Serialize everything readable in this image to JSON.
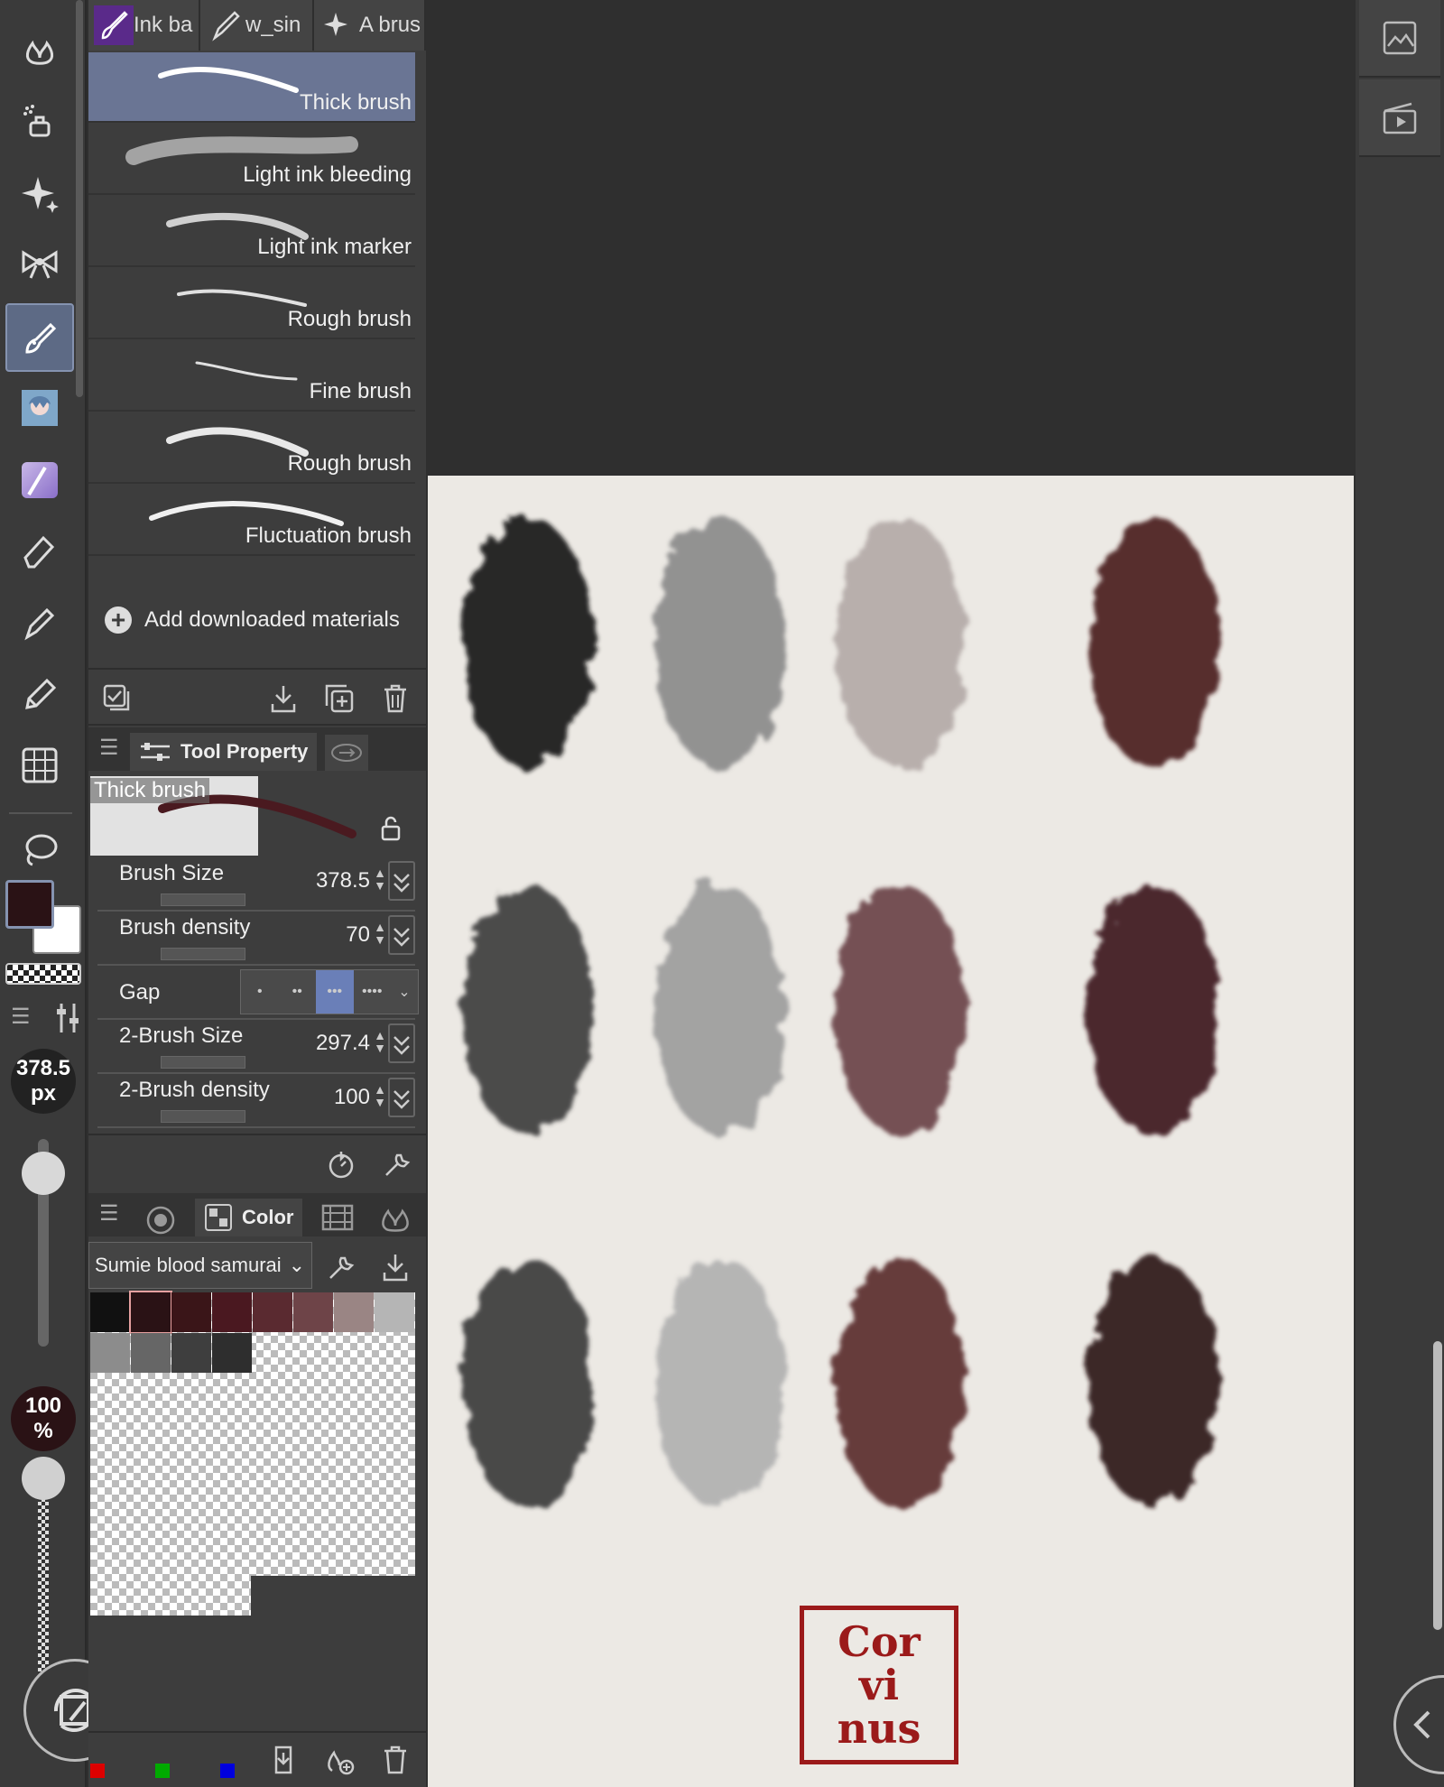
{
  "brush_tabs": [
    {
      "label": "Ink ba",
      "selected": true
    },
    {
      "label": "w_sin",
      "selected": false
    },
    {
      "label": "A brus",
      "selected": false
    }
  ],
  "brush_list": {
    "items": [
      {
        "label": "Thick brush",
        "selected": true
      },
      {
        "label": "Light ink bleeding",
        "selected": false
      },
      {
        "label": "Light ink marker",
        "selected": false
      },
      {
        "label": "Rough brush",
        "selected": false
      },
      {
        "label": "Fine brush",
        "selected": false
      },
      {
        "label": "Rough brush",
        "selected": false
      },
      {
        "label": "Fluctuation brush",
        "selected": false
      }
    ],
    "add_label": "Add downloaded materials"
  },
  "tool_property": {
    "tab_label": "Tool Property",
    "preview_label": "Thick brush",
    "brush_size": {
      "label": "Brush Size",
      "value": "378.5"
    },
    "brush_density": {
      "label": "Brush density",
      "value": "70"
    },
    "gap": {
      "label": "Gap",
      "options": [
        "•",
        "••",
        "•••",
        "••••"
      ],
      "selected_index": 2
    },
    "brush_size_2": {
      "label": "2-Brush Size",
      "value": "297.4"
    },
    "brush_density_2": {
      "label": "2-Brush density",
      "value": "100"
    }
  },
  "left_bar": {
    "size_value": "378.5",
    "size_unit": "px",
    "opacity_value": "100",
    "opacity_unit": "%",
    "foreground_color": "#2a1215",
    "background_color": "#ffffff"
  },
  "color_panel": {
    "tab_label": "Color",
    "palette_name": "Sumie blood samurai",
    "swatches": [
      "#111111",
      "#2a1215",
      "#3a1518",
      "#4a1820",
      "#5a2a30",
      "#6e4448",
      "#9a8584",
      "#b5b5b5",
      "#8c8c8c",
      "#666666",
      "#3e3e3e",
      "#2e2e2e"
    ],
    "selected_swatch": 1
  },
  "canvas": {
    "stamp_lines": [
      "Cor",
      "vi",
      "nus"
    ],
    "stamp_color": "#9b1a1a",
    "blob_colors": [
      [
        "#1a1a1a",
        "#8a8a8a",
        "#b3a9a7",
        "#4a1c20"
      ],
      [
        "#3d3d3d",
        "#9c9c9c",
        "#6a4246",
        "#3e1a1e"
      ],
      [
        "#3a3a3a",
        "#b0b0b0",
        "#5a2a2e",
        "#2e1416"
      ]
    ]
  },
  "colors": {
    "accent": "#6a7594",
    "panel": "#3d3d3d",
    "paper": "#ece9e4"
  }
}
